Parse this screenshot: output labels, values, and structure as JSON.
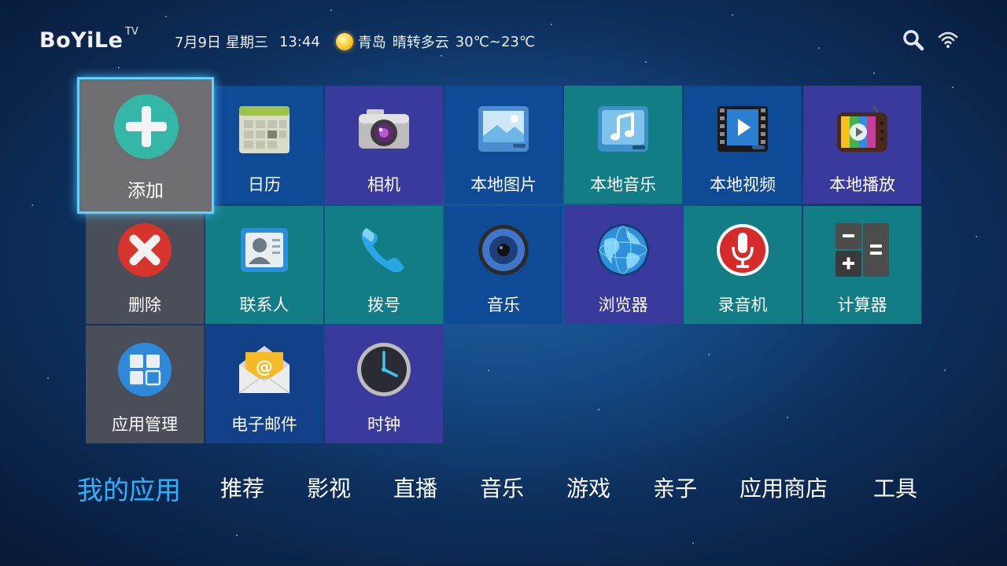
{
  "header": {
    "logo": "BoYiLe",
    "logo_tv": "TV",
    "date": "7月9日",
    "weekday": "星期三",
    "time": "13:44",
    "city": "青岛",
    "weather": "晴转多云",
    "temperature": "30℃~23℃"
  },
  "tiles": [
    {
      "label": "添加",
      "icon": "add-icon"
    },
    {
      "label": "日历",
      "icon": "calendar-icon"
    },
    {
      "label": "相机",
      "icon": "camera-icon"
    },
    {
      "label": "本地图片",
      "icon": "local-pictures-icon"
    },
    {
      "label": "本地音乐",
      "icon": "local-music-icon"
    },
    {
      "label": "本地视频",
      "icon": "local-video-icon"
    },
    {
      "label": "本地播放",
      "icon": "local-play-icon"
    },
    {
      "label": "删除",
      "icon": "delete-icon"
    },
    {
      "label": "联系人",
      "icon": "contacts-icon"
    },
    {
      "label": "拨号",
      "icon": "phone-icon"
    },
    {
      "label": "音乐",
      "icon": "speaker-icon"
    },
    {
      "label": "浏览器",
      "icon": "globe-icon"
    },
    {
      "label": "录音机",
      "icon": "microphone-icon"
    },
    {
      "label": "计算器",
      "icon": "calculator-icon"
    },
    {
      "label": "应用管理",
      "icon": "app-manager-icon"
    },
    {
      "label": "电子邮件",
      "icon": "email-icon"
    },
    {
      "label": "时钟",
      "icon": "clock-icon"
    }
  ],
  "nav": [
    {
      "label": "我的应用",
      "active": true
    },
    {
      "label": "推荐"
    },
    {
      "label": "影视"
    },
    {
      "label": "直播"
    },
    {
      "label": "音乐"
    },
    {
      "label": "游戏"
    },
    {
      "label": "亲子"
    },
    {
      "label": "应用商店"
    },
    {
      "label": "工具"
    }
  ],
  "colors": {
    "accent": "#2ab4ff",
    "focus_border": "#5fd2ff",
    "tile_blue": "#0f4a97",
    "tile_purple": "#3a3a9c",
    "tile_teal": "#137d86",
    "tile_gray": "#4a4e58"
  }
}
